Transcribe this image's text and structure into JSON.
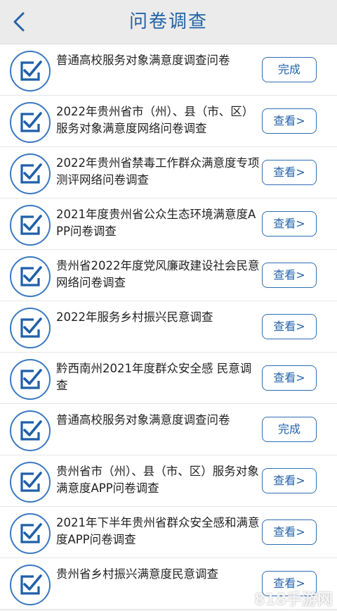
{
  "header": {
    "title": "问卷调查"
  },
  "colors": {
    "accent": "#2563a6",
    "icon_ring": "#3a78c2",
    "button_border": "#2e6db5"
  },
  "icons": {
    "back": "chevron-left-icon",
    "item": "checkbox-checked-icon"
  },
  "surveys": [
    {
      "title": "普通高校服务对象满意度调查问卷",
      "button": "完成"
    },
    {
      "title": "2022年贵州省市（州）、县（市、区）服务对象满意度网络问卷调查",
      "button": "查看>"
    },
    {
      "title": "2022年贵州省禁毒工作群众满意度专项测评网络问卷调查",
      "button": "查看>"
    },
    {
      "title": "2021年度贵州省公众生态环境满意度APP问卷调查",
      "button": "查看>"
    },
    {
      "title": "贵州省2022年度党风廉政建设社会民意网络问卷调查",
      "button": "查看>"
    },
    {
      "title": "2022年服务乡村振兴民意调查",
      "button": "查看>"
    },
    {
      "title": "黔西南州2021年度群众安全感 民意调查",
      "button": "查看>"
    },
    {
      "title": "普通高校服务对象满意度调查问卷",
      "button": "完成"
    },
    {
      "title": "贵州省市（州）、县（市、区）服务对象满意度APP问卷调查",
      "button": "查看>"
    },
    {
      "title": "2021年下半年贵州省群众安全感和满意度APP问卷调查",
      "button": "查看>"
    },
    {
      "title": "贵州省乡村振兴满意度民意调查",
      "button": "查看>"
    }
  ],
  "watermark": "818手游网"
}
